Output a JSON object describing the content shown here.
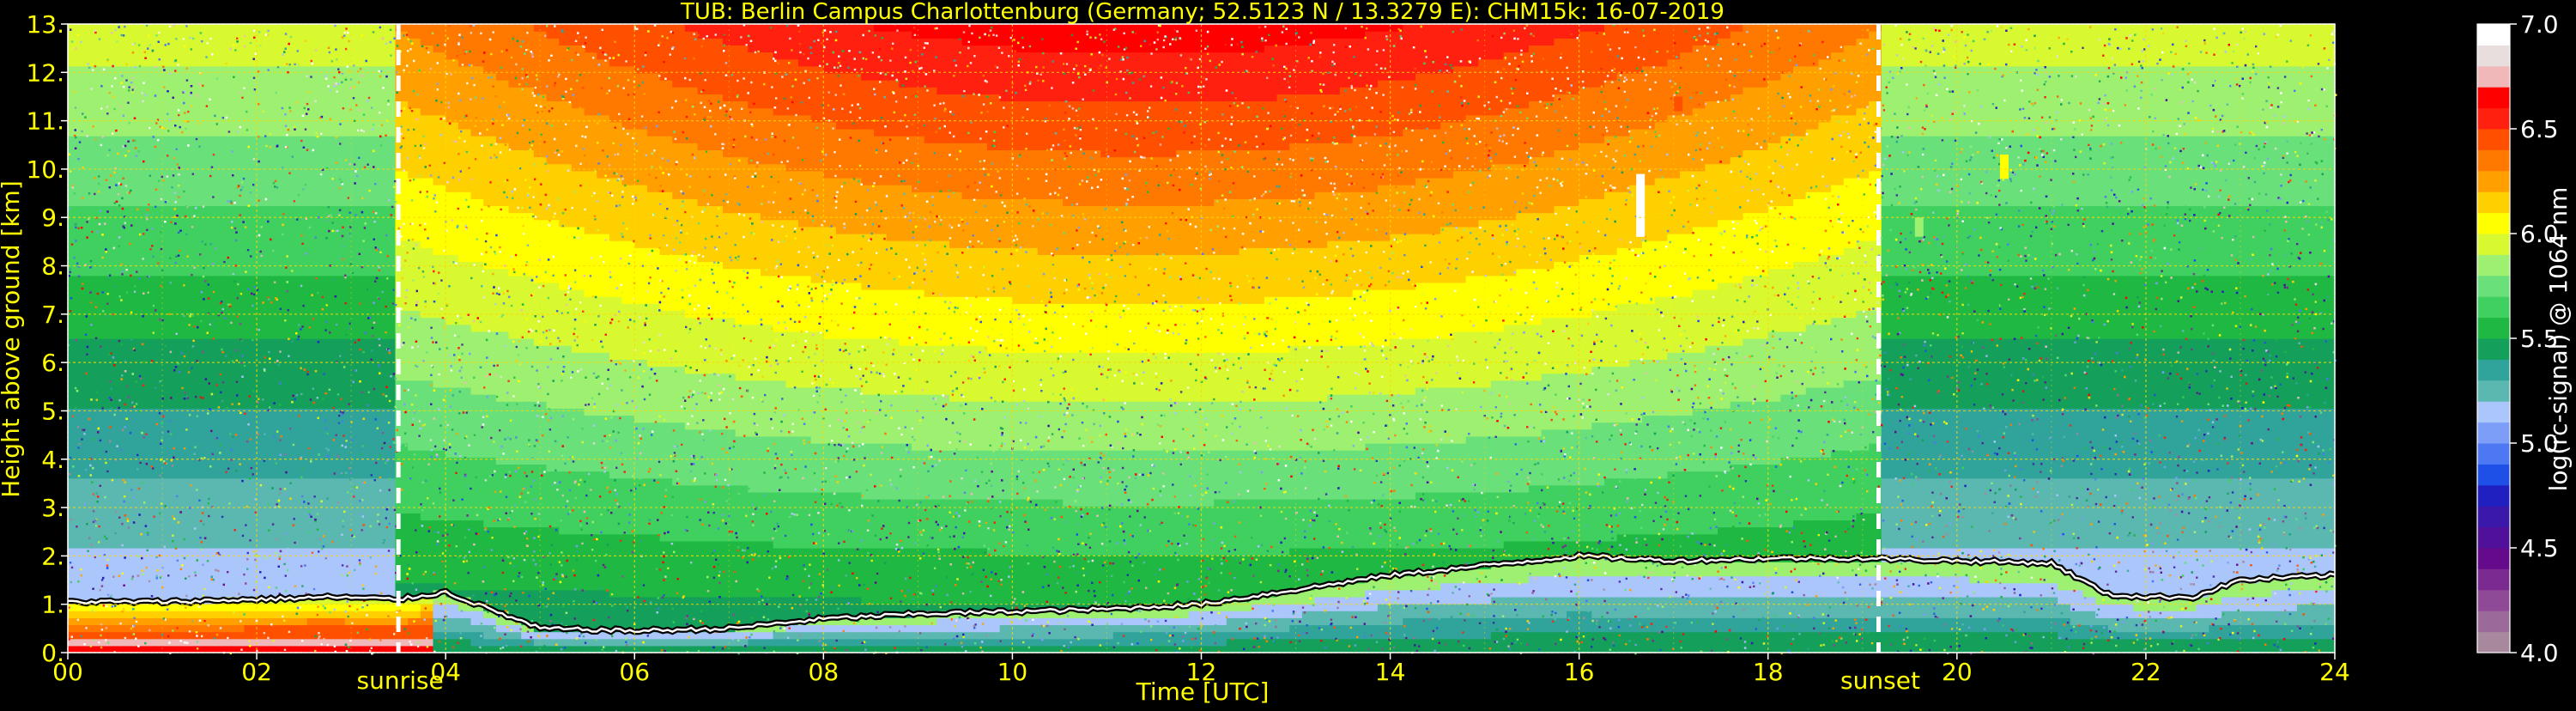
{
  "chart_data": {
    "type": "heatmap",
    "title": "TUB: Berlin Campus Charlottenburg (Germany; 52.5123 N / 13.3279 E):    CHM15k: 16-07-2019",
    "xlabel": "Time [UTC]",
    "ylabel": "Height above ground [km]",
    "xlim": [
      0,
      24
    ],
    "ylim": [
      0,
      13
    ],
    "x_ticks": [
      0,
      2,
      4,
      6,
      8,
      10,
      12,
      14,
      16,
      18,
      20,
      22,
      24
    ],
    "x_tick_labels": [
      "00",
      "02",
      "04",
      "06",
      "08",
      "10",
      "12",
      "14",
      "16",
      "18",
      "20",
      "22",
      "24"
    ],
    "y_ticks": [
      0,
      1,
      2,
      3,
      4,
      5,
      6,
      7,
      8,
      9,
      10,
      11,
      12,
      13
    ],
    "y_tick_labels": [
      "0.",
      "1.",
      "2.",
      "3.",
      "4.",
      "5.",
      "6.",
      "7.",
      "8.",
      "9.",
      "10.",
      "11.",
      "12.",
      "13."
    ],
    "grid": true,
    "colorbar": {
      "label": "log(rc-signal) @ 1064 nm",
      "range": [
        4.0,
        7.0
      ],
      "ticks": [
        4.0,
        4.5,
        5.0,
        5.5,
        6.0,
        6.5,
        7.0
      ],
      "tick_labels": [
        "4.0",
        "4.5",
        "5.0",
        "5.5",
        "6.0",
        "6.5",
        "7.0"
      ],
      "colors": [
        "#a8889c",
        "#9c6a9a",
        "#8e4a96",
        "#7a2a90",
        "#660a8c",
        "#50109a",
        "#3a18aa",
        "#2020c0",
        "#1e50e8",
        "#4c78f4",
        "#7c9ef8",
        "#aac6fa",
        "#5ab8b0",
        "#30a49a",
        "#14a05a",
        "#1eb842",
        "#40d060",
        "#6ae07a",
        "#9ef070",
        "#d8f830",
        "#ffff00",
        "#ffd000",
        "#ffa000",
        "#ff7800",
        "#ff5000",
        "#ff2010",
        "#ff0000",
        "#f0b8b8",
        "#e8dede",
        "#ffffff"
      ]
    },
    "markers": [
      {
        "label": "sunrise",
        "x": 3.5
      },
      {
        "label": "sunset",
        "x": 19.17
      }
    ],
    "boundary_layer_top_km": {
      "time_h": [
        0,
        1,
        2,
        2.8,
        3.5,
        4,
        5,
        6,
        7,
        8,
        9,
        10,
        11,
        12,
        13,
        14,
        15,
        15.5,
        16,
        17,
        18,
        19,
        20,
        21,
        21.6,
        22,
        22.5,
        23,
        24
      ],
      "height_km": [
        1.05,
        1.05,
        1.1,
        1.15,
        1.1,
        1.25,
        0.5,
        0.45,
        0.5,
        0.7,
        0.8,
        0.85,
        0.9,
        1.0,
        1.3,
        1.6,
        1.8,
        1.9,
        2.0,
        1.9,
        1.95,
        1.95,
        1.9,
        1.85,
        1.2,
        1.15,
        1.15,
        1.5,
        1.6
      ]
    },
    "cloud_features": [
      {
        "time_h": 16.65,
        "height_km": [
          8.6,
          9.9
        ],
        "value": 7.0
      },
      {
        "time_h": 17.05,
        "height_km": [
          11.2,
          11.5
        ],
        "value": 6.4
      },
      {
        "time_h": 20.5,
        "height_km": [
          9.8,
          10.3
        ],
        "value": 6.0
      },
      {
        "time_h": 19.6,
        "height_km": [
          8.6,
          9.0
        ],
        "value": 5.8
      }
    ]
  }
}
